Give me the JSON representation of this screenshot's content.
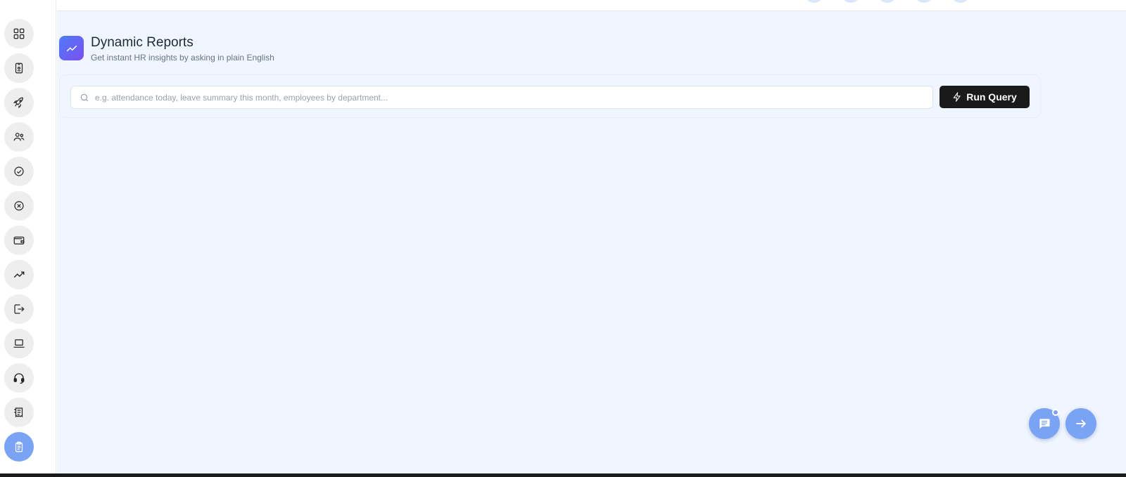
{
  "sidebar": {
    "items": [
      {
        "icon": "dashboard-grid-icon"
      },
      {
        "icon": "id-card-icon"
      },
      {
        "icon": "rocket-icon"
      },
      {
        "icon": "users-icon"
      },
      {
        "icon": "approval-check-icon"
      },
      {
        "icon": "cancel-circle-icon"
      },
      {
        "icon": "wallet-icon"
      },
      {
        "icon": "trend-line-icon"
      },
      {
        "icon": "logout-icon"
      },
      {
        "icon": "laptop-icon"
      },
      {
        "icon": "headset-icon"
      },
      {
        "icon": "receipt-icon"
      },
      {
        "icon": "clipboard-icon",
        "active": true
      }
    ]
  },
  "header": {
    "title": "Dynamic Reports",
    "subtitle": "Get instant HR insights by asking in plain English"
  },
  "query": {
    "placeholder": "e.g. attendance today, leave summary this month, employees by department...",
    "value": "",
    "run_label": "Run Query"
  },
  "floating": {
    "chat_icon": "chat-icon",
    "next_icon": "arrow-right-icon"
  },
  "colors": {
    "main_bg": "#f0f6ff",
    "accent": "#7ba3f3",
    "button_dark": "#1a1a1a",
    "header_gradient_start": "#4f7cf7",
    "header_gradient_end": "#7b4ef0"
  }
}
